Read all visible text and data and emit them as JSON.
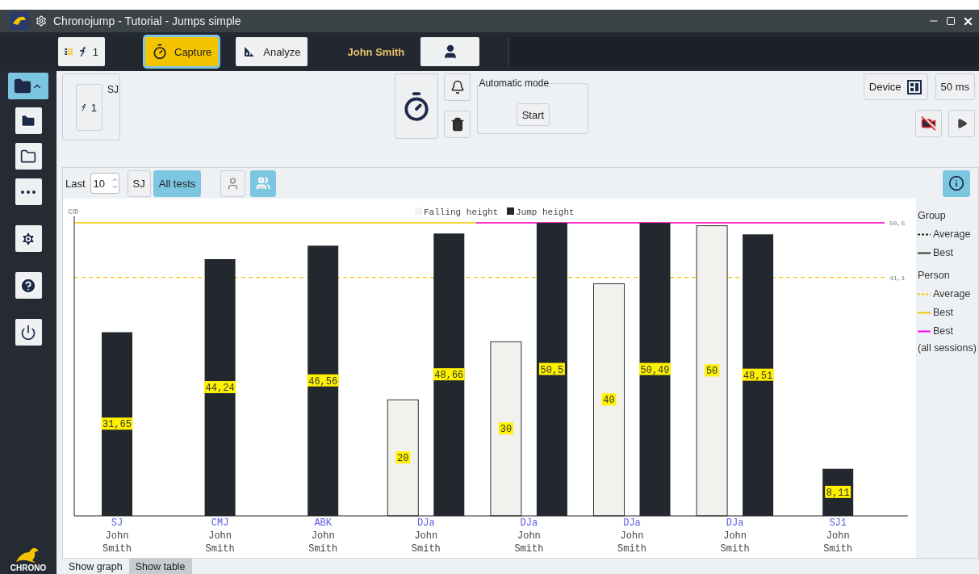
{
  "window": {
    "title": "Chronojump - Tutorial - Jumps simple"
  },
  "toolbar": {
    "mode_badge": "1",
    "tabs": [
      {
        "kind": "capture",
        "label": "Capture",
        "selected": true
      },
      {
        "kind": "analyze",
        "label": "Analyze",
        "selected": false
      }
    ],
    "person": "John Smith"
  },
  "sidebar": {
    "items": [
      {
        "kind": "session",
        "selected": true
      },
      {
        "kind": "new-session",
        "selected": false
      },
      {
        "kind": "load-session",
        "selected": false
      },
      {
        "kind": "more",
        "selected": false
      },
      {
        "kind": "settings",
        "selected": false
      },
      {
        "kind": "help",
        "selected": false
      },
      {
        "kind": "quit",
        "selected": false
      }
    ],
    "logo": "CHRONO"
  },
  "test_type": {
    "badge": "1",
    "label": "SJ"
  },
  "automatic_mode": {
    "title": "Automatic mode",
    "button": "Start"
  },
  "device": {
    "button": "Device",
    "interval": "50 ms"
  },
  "graph_toolbar": {
    "last_label": "Last",
    "last_value": "10",
    "filters": [
      {
        "label": "SJ",
        "selected": false
      },
      {
        "label": "All tests",
        "selected": true
      }
    ],
    "scope": [
      {
        "kind": "person",
        "selected": false
      },
      {
        "kind": "group",
        "selected": true
      }
    ]
  },
  "chart_data": {
    "type": "bar",
    "ylabel": "cm",
    "ylim": [
      0,
      50.5
    ],
    "legend": "top",
    "categories": [
      "SJ John Smith",
      "CMJ John Smith",
      "ABK John Smith",
      "DJa John Smith",
      "DJa John Smith",
      "DJa John Smith",
      "DJa John Smith",
      "SJ1 John Smith"
    ],
    "series": [
      {
        "name": "Falling height",
        "color": "#f3f1ee",
        "values": [
          null,
          null,
          null,
          20,
          30,
          40,
          50,
          null
        ],
        "value_labels": [
          null,
          null,
          null,
          "20",
          "30",
          "40",
          "50",
          null
        ]
      },
      {
        "name": "Jump height",
        "color": "#23272e",
        "values": [
          31.65,
          44.24,
          46.56,
          48.66,
          50.5,
          50.49,
          48.51,
          8.11
        ],
        "value_labels": [
          "31,65",
          "44,24",
          "46,56",
          "48,66",
          "50,5",
          "50,49",
          "48,51",
          "8,11"
        ]
      }
    ],
    "ref_lines": [
      {
        "axis": "y",
        "value": 50.5,
        "color": "#f5c400"
      },
      {
        "axis": "y",
        "value": 50.5,
        "label": "50,5",
        "color": "#ff00ff"
      },
      {
        "axis": "y",
        "value": 41.1,
        "label": "41,1",
        "color": "#f5c400"
      }
    ]
  },
  "legend_panel": [
    {
      "heading": "Group",
      "items": [
        {
          "kind": "average",
          "label": "Average",
          "color": "#222222"
        },
        {
          "kind": "best",
          "label": "Best",
          "color": "#333333"
        }
      ]
    },
    {
      "heading": "Person",
      "items": [
        {
          "kind": "average",
          "label": "Average",
          "color": "#f5c400"
        },
        {
          "kind": "best",
          "label": "Best",
          "color": "#f5c400"
        },
        {
          "kind": "best",
          "label": "Best",
          "note": "(all sessions)",
          "color": "#ff00ff"
        }
      ]
    }
  ],
  "bottom_tabs": [
    {
      "label": "Show graph",
      "selected": true
    },
    {
      "label": "Show table",
      "selected": false
    }
  ]
}
